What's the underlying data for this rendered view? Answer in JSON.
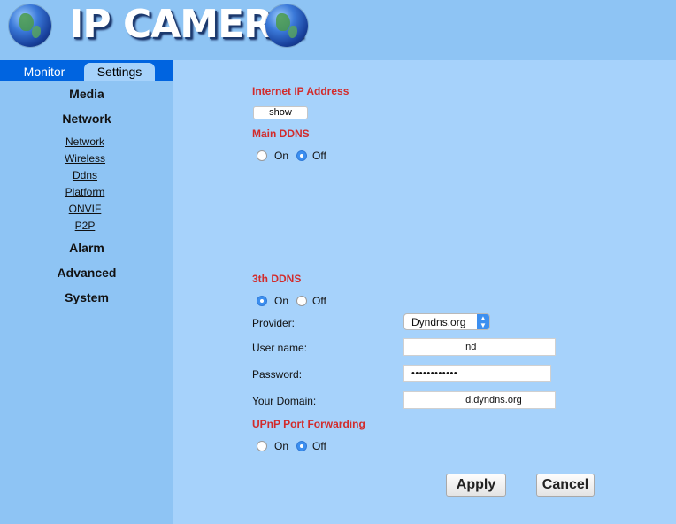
{
  "header": {
    "logo_text": "IP CAMERA"
  },
  "tabs": {
    "monitor": "Monitor",
    "settings": "Settings"
  },
  "sidebar": {
    "media": "Media",
    "network": "Network",
    "sub": [
      "Network",
      "Wireless",
      "Ddns",
      "Platform",
      "ONVIF",
      "P2P"
    ],
    "alarm": "Alarm",
    "advanced": "Advanced",
    "system": "System"
  },
  "content": {
    "internet_ip_title": "Internet IP Address",
    "show_label": "show",
    "main_ddns_title": "Main DDNS",
    "main_ddns": {
      "on_label": "On",
      "off_label": "Off",
      "selected": "Off"
    },
    "third_ddns_title": "3th DDNS",
    "third_ddns": {
      "on_label": "On",
      "off_label": "Off",
      "selected": "On"
    },
    "provider_label": "Provider:",
    "provider_value": "Dyndns.org",
    "username_label": "User name:",
    "username_value": "                    nd",
    "password_label": "Password:",
    "password_value": "••••••••••••",
    "domain_label": "Your Domain:",
    "domain_value": "                    d.dyndns.org",
    "upnp_title": "UPnP Port Forwarding",
    "upnp": {
      "on_label": "On",
      "off_label": "Off",
      "selected": "Off"
    },
    "apply_label": "Apply",
    "cancel_label": "Cancel"
  },
  "colors": {
    "accent": "#0064e0",
    "section_title": "#d22b2b",
    "background": "#a6d2fb",
    "sidebar": "#8ec4f4"
  }
}
